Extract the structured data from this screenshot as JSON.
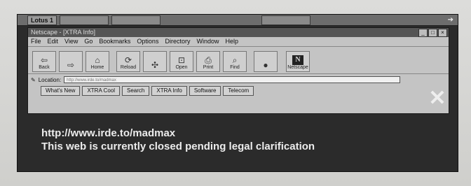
{
  "taskbar": {
    "tabs": [
      {
        "label": "Lotus 1"
      },
      {
        "label": ""
      },
      {
        "label": ""
      },
      {
        "label": ""
      }
    ]
  },
  "window": {
    "title": "Netscape - [XTRA Info]",
    "controls": [
      "_",
      "□",
      "×"
    ]
  },
  "menu": [
    "File",
    "Edit",
    "View",
    "Go",
    "Bookmarks",
    "Options",
    "Directory",
    "Window",
    "Help"
  ],
  "toolbar": [
    {
      "label": "Back",
      "icon": "back-arrow-icon",
      "glyph": "⇦"
    },
    {
      "label": "",
      "icon": "forward-arrow-icon",
      "glyph": "⇨"
    },
    {
      "label": "Home",
      "icon": "home-icon",
      "glyph": "⌂"
    },
    {
      "label": "Reload",
      "icon": "reload-icon",
      "glyph": "⟳"
    },
    {
      "label": "",
      "icon": "images-icon",
      "glyph": "✣"
    },
    {
      "label": "Open",
      "icon": "open-icon",
      "glyph": "⊡"
    },
    {
      "label": "Print",
      "icon": "print-icon",
      "glyph": "⎙"
    },
    {
      "label": "Find",
      "icon": "find-icon",
      "glyph": "⌕"
    },
    {
      "label": "",
      "icon": "stop-icon",
      "glyph": "●"
    },
    {
      "label": "Netscape",
      "icon": "netscape-logo-icon",
      "glyph": "N"
    }
  ],
  "location": {
    "label": "Location:",
    "value": "http://www.irde.to/madmax"
  },
  "directory_buttons": [
    "What's New",
    "XTRA Cool",
    "Search",
    "XTRA Info",
    "Software",
    "Telecom"
  ],
  "content": {
    "line1": "http://www.irde.to/madmax",
    "line2": "This web is currently closed pending legal clarification"
  }
}
